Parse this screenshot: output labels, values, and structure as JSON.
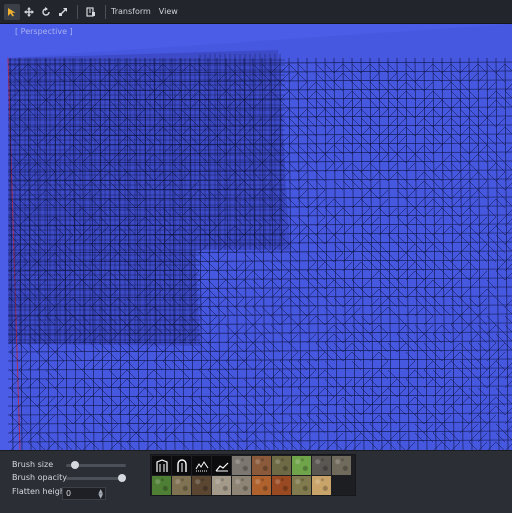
{
  "toolbar": {
    "tools": [
      {
        "name": "select-tool",
        "active": true
      },
      {
        "name": "move-tool",
        "active": false
      },
      {
        "name": "rotate-tool",
        "active": false
      },
      {
        "name": "scale-tool",
        "active": false
      },
      {
        "name": "snap-tool",
        "active": false
      }
    ],
    "menus": [
      "Transform",
      "View"
    ]
  },
  "viewport": {
    "label": "[ Perspective ]"
  },
  "panel": {
    "brush_size_label": "Brush size",
    "brush_size_value": 0.1,
    "brush_opacity_label": "Brush opacity",
    "brush_opacity_value": 1.0,
    "flatten_height_label": "Flatten height",
    "flatten_height_value": "0"
  },
  "palette": {
    "brushes": [
      "brush-1",
      "brush-2",
      "brush-3",
      "brush-4"
    ],
    "textures": [
      {
        "name": "grey-rock",
        "color": "#7c7770"
      },
      {
        "name": "brown-dirt",
        "color": "#8a5a3b"
      },
      {
        "name": "mossy-dirt",
        "color": "#6d6a45"
      },
      {
        "name": "green-grass",
        "color": "#6fa44a"
      },
      {
        "name": "dark-stone",
        "color": "#5a5652"
      },
      {
        "name": "stone-moss",
        "color": "#6f6a5b"
      },
      {
        "name": "grass-patch",
        "color": "#4f7f35"
      },
      {
        "name": "tan-soil",
        "color": "#7f7253"
      },
      {
        "name": "dark-soil",
        "color": "#5b4632"
      },
      {
        "name": "light-stone",
        "color": "#a39a8a"
      },
      {
        "name": "pebbles",
        "color": "#8e8476"
      },
      {
        "name": "orange-clay",
        "color": "#b0622e"
      },
      {
        "name": "rust-clay",
        "color": "#9a4a22"
      },
      {
        "name": "olive-ground",
        "color": "#807a4e"
      },
      {
        "name": "sand",
        "color": "#c8a46a"
      }
    ]
  }
}
